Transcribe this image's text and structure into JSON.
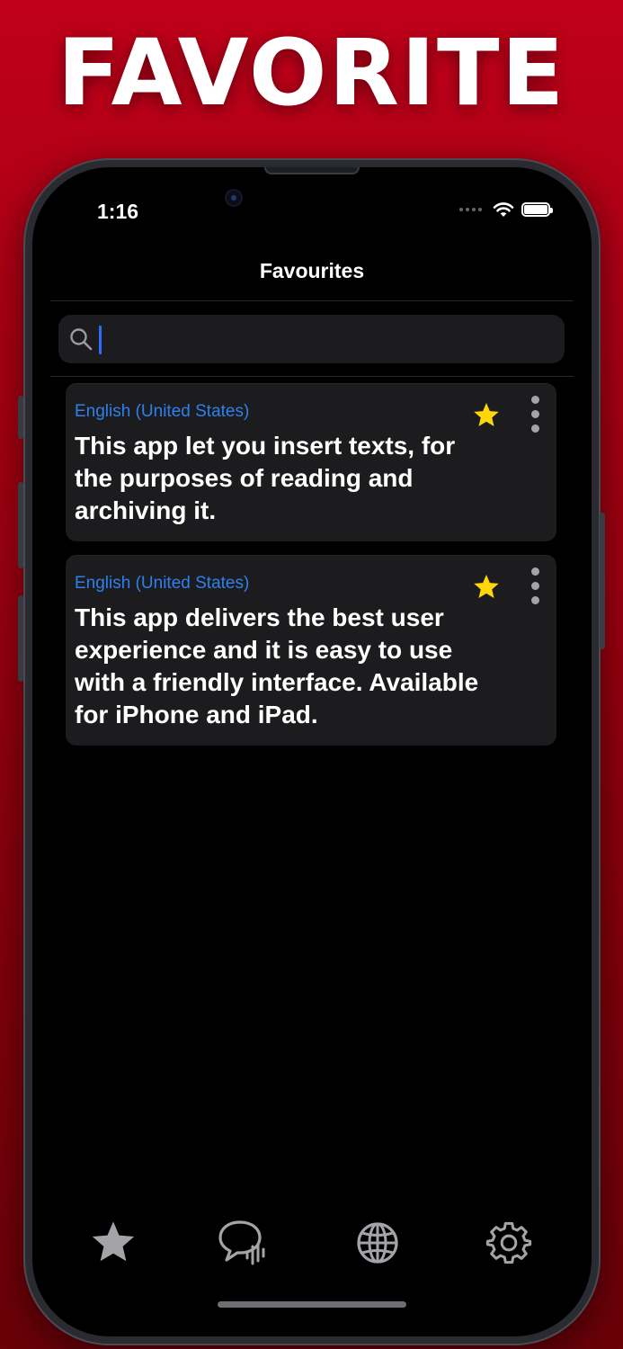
{
  "promo": {
    "headline": "FAVORITE"
  },
  "status_bar": {
    "time": "1:16"
  },
  "nav": {
    "title": "Favourites"
  },
  "search": {
    "value": "",
    "placeholder": ""
  },
  "favourites": [
    {
      "language": "English (United States)",
      "text": "This app let you insert texts, for the purposes of reading and archiving it.",
      "starred": true
    },
    {
      "language": "English (United States)",
      "text": "This app delivers the best user experience and it is easy to use with a friendly interface. Available for iPhone and iPad.",
      "starred": true
    }
  ],
  "tab_bar": {
    "items": [
      {
        "icon": "star-icon",
        "active": true
      },
      {
        "icon": "speech-bubble-icon",
        "active": false
      },
      {
        "icon": "globe-icon",
        "active": false
      },
      {
        "icon": "gear-icon",
        "active": false
      }
    ]
  },
  "colors": {
    "background_top": "#c0001a",
    "background_bottom": "#6a0008",
    "accent_blue": "#2f80ed",
    "star_yellow": "#ffd60a",
    "card_bg": "#1c1c1e",
    "icon_gray": "#a3a3a8"
  }
}
